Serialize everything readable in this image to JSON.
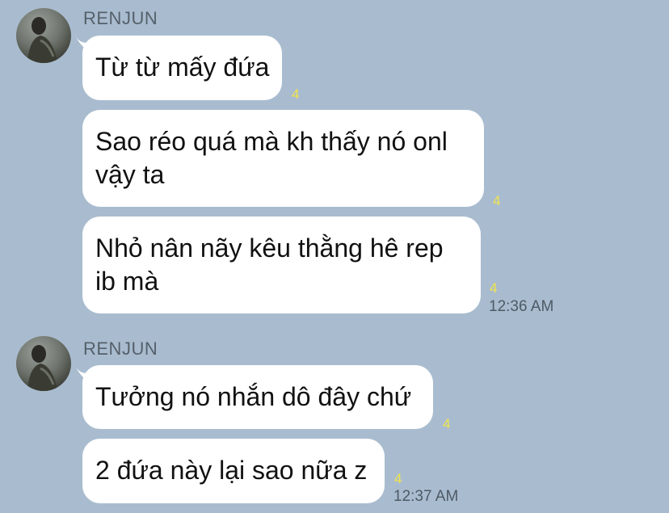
{
  "groups": [
    {
      "sender": "RENJUN",
      "messages": [
        {
          "lines": [
            "Từ từ mấy đứa"
          ],
          "read_count": "4"
        },
        {
          "lines": [
            "Sao réo quá mà kh thấy nó onl",
            "vậy ta"
          ],
          "read_count": "4"
        },
        {
          "lines": [
            "Nhỏ nân nãy kêu thằng hê rep",
            "ib mà"
          ],
          "read_count": "4"
        }
      ],
      "time": "12:36 AM"
    },
    {
      "sender": "RENJUN",
      "messages": [
        {
          "lines": [
            "Tưởng nó nhắn dô đây chứ"
          ],
          "read_count": "4"
        },
        {
          "lines": [
            "2 đứa này lại sao nữa z"
          ],
          "read_count": "4"
        }
      ],
      "time": "12:37 AM"
    }
  ],
  "colors": {
    "background": "#a9bccf",
    "bubble": "#ffffff",
    "read_count": "#f2e44a"
  },
  "icons": [
    "avatar"
  ]
}
